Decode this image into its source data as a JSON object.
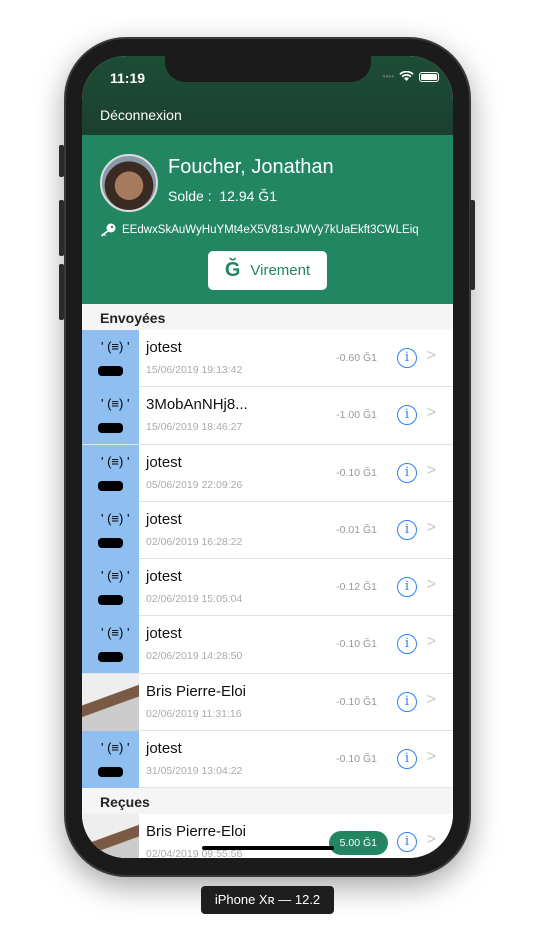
{
  "status": {
    "time": "11:19"
  },
  "nav": {
    "logout": "Déconnexion"
  },
  "profile": {
    "name": "Foucher, Jonathan",
    "balance_label": "Solde :",
    "balance": "12.94 Ğ1",
    "pubkey": "EEdwxSkAuWyHuYMt4eX5V81srJWVy7kUaEkft3CWLEiq",
    "transfer_button": "Virement",
    "transfer_icon": "Ğ"
  },
  "sent": {
    "title": "Envoyées",
    "items": [
      {
        "name": "jotest",
        "date": "15/06/2019 19:13:42",
        "amount": "-0.60 Ğ1",
        "avatar": "robot"
      },
      {
        "name": "3MobAnNHj8...",
        "date": "15/06/2019 18:46:27",
        "amount": "-1.00 Ğ1",
        "avatar": "robot"
      },
      {
        "name": "jotest",
        "date": "05/06/2019 22:09:26",
        "amount": "-0.10 Ğ1",
        "avatar": "robot"
      },
      {
        "name": "jotest",
        "date": "02/06/2019 16:28:22",
        "amount": "-0.01 Ğ1",
        "avatar": "robot"
      },
      {
        "name": "jotest",
        "date": "02/06/2019 15:05:04",
        "amount": "-0.12 Ğ1",
        "avatar": "robot"
      },
      {
        "name": "jotest",
        "date": "02/06/2019 14:28:50",
        "amount": "-0.10 Ğ1",
        "avatar": "robot"
      },
      {
        "name": "Bris Pierre-Eloi",
        "date": "02/06/2019 11:31:16",
        "amount": "-0.10 Ğ1",
        "avatar": "photo"
      },
      {
        "name": "jotest",
        "date": "31/05/2019 13:04:22",
        "amount": "-0.10 Ğ1",
        "avatar": "robot"
      }
    ]
  },
  "received": {
    "title": "Reçues",
    "items": [
      {
        "name": "Bris Pierre-Eloi",
        "date": "02/04/2019 09:55:56",
        "amount": "5.00 Ğ1",
        "avatar": "photo"
      }
    ]
  },
  "device_label": "iPhone Xʀ — 12.2",
  "colors": {
    "primary": "#238663",
    "accent": "#2f82f2"
  }
}
